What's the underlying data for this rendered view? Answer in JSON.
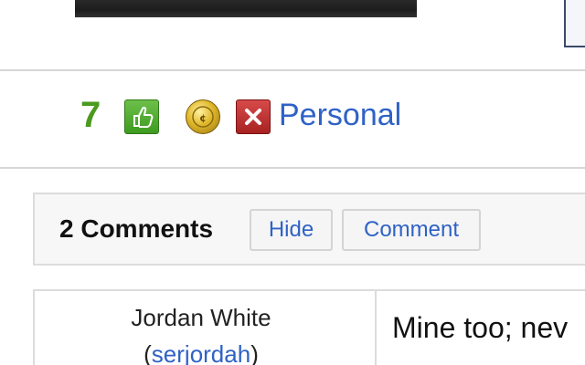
{
  "post": {
    "vote_count": "7",
    "tag_label": "Personal"
  },
  "icons": {
    "thumb": "thumbs-up-icon",
    "coin": "coin-icon",
    "close": "close-icon"
  },
  "comments_panel": {
    "title": "2 Comments",
    "hide_label": "Hide",
    "comment_label": "Comment"
  },
  "comment": {
    "author_name": "Jordan White",
    "author_handle": "serjordah",
    "text": "Mine too; nev"
  },
  "colors": {
    "link": "#2f62c6",
    "vote_green": "#4a9a1e"
  }
}
